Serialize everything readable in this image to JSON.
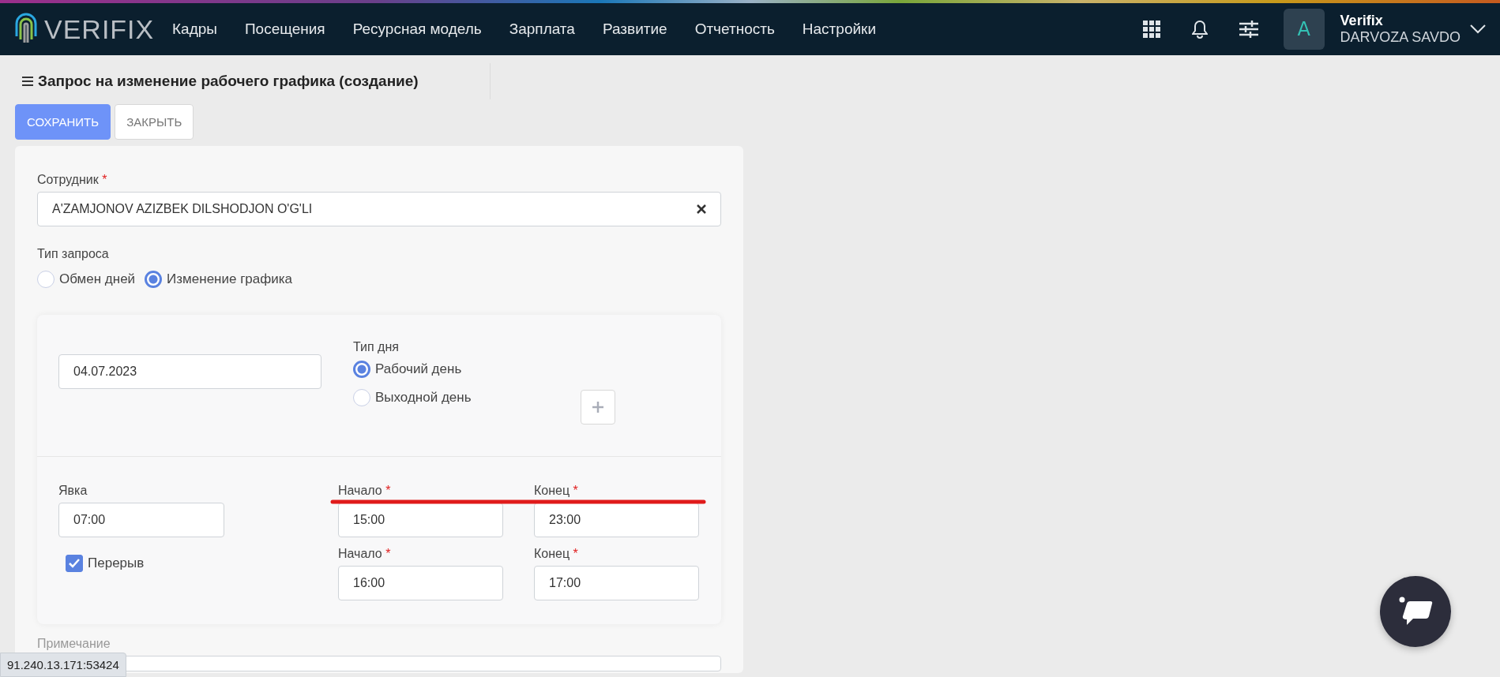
{
  "header": {
    "logo_text": "VERIFIX",
    "nav": [
      {
        "label": "Кадры"
      },
      {
        "label": "Посещения"
      },
      {
        "label": "Ресурсная модель"
      },
      {
        "label": "Зарплата"
      },
      {
        "label": "Развитие"
      },
      {
        "label": "Отчетность"
      },
      {
        "label": "Настройки"
      }
    ],
    "user": {
      "avatar_letter": "A",
      "name": "Verifix",
      "company": "DARVOZA SAVDO"
    }
  },
  "page": {
    "title": "Запрос на изменение рабочего графика (создание)",
    "buttons": [
      {
        "label": "СОХРАНИТЬ",
        "kind": "primary"
      },
      {
        "label": "ЗАКРЫТЬ",
        "kind": "default"
      }
    ]
  },
  "form": {
    "employee": {
      "label": "Сотрудник",
      "mark": "*",
      "value": "A'ZAMJONOV AZIZBEK DILSHODJON O'G'LI"
    },
    "request_type": {
      "label": "Тип запроса",
      "options": [
        {
          "label": "Обмен дней",
          "selected": false
        },
        {
          "label": "Изменение графика",
          "selected": true
        }
      ]
    },
    "schedule": {
      "date": "04.07.2023",
      "day_type": {
        "label": "Тип дня",
        "options": [
          {
            "label": "Рабочий день",
            "selected": true
          },
          {
            "label": "Выходной день",
            "selected": false
          }
        ]
      },
      "attendance": {
        "label": "Явка",
        "value": "07:00"
      },
      "break": {
        "label": "Перерыв",
        "checked": true
      },
      "work_time": [
        {
          "label": "Начало",
          "mark": "*",
          "value": "15:00"
        },
        {
          "label": "Конец",
          "mark": "*",
          "value": "23:00"
        }
      ],
      "break_time": [
        {
          "label": "Начало",
          "mark": "*",
          "value": "16:00"
        },
        {
          "label": "Конец",
          "mark": "*",
          "value": "17:00"
        }
      ]
    },
    "note": {
      "label": "Примечание"
    }
  },
  "status_url": "91.240.13.171:53424"
}
